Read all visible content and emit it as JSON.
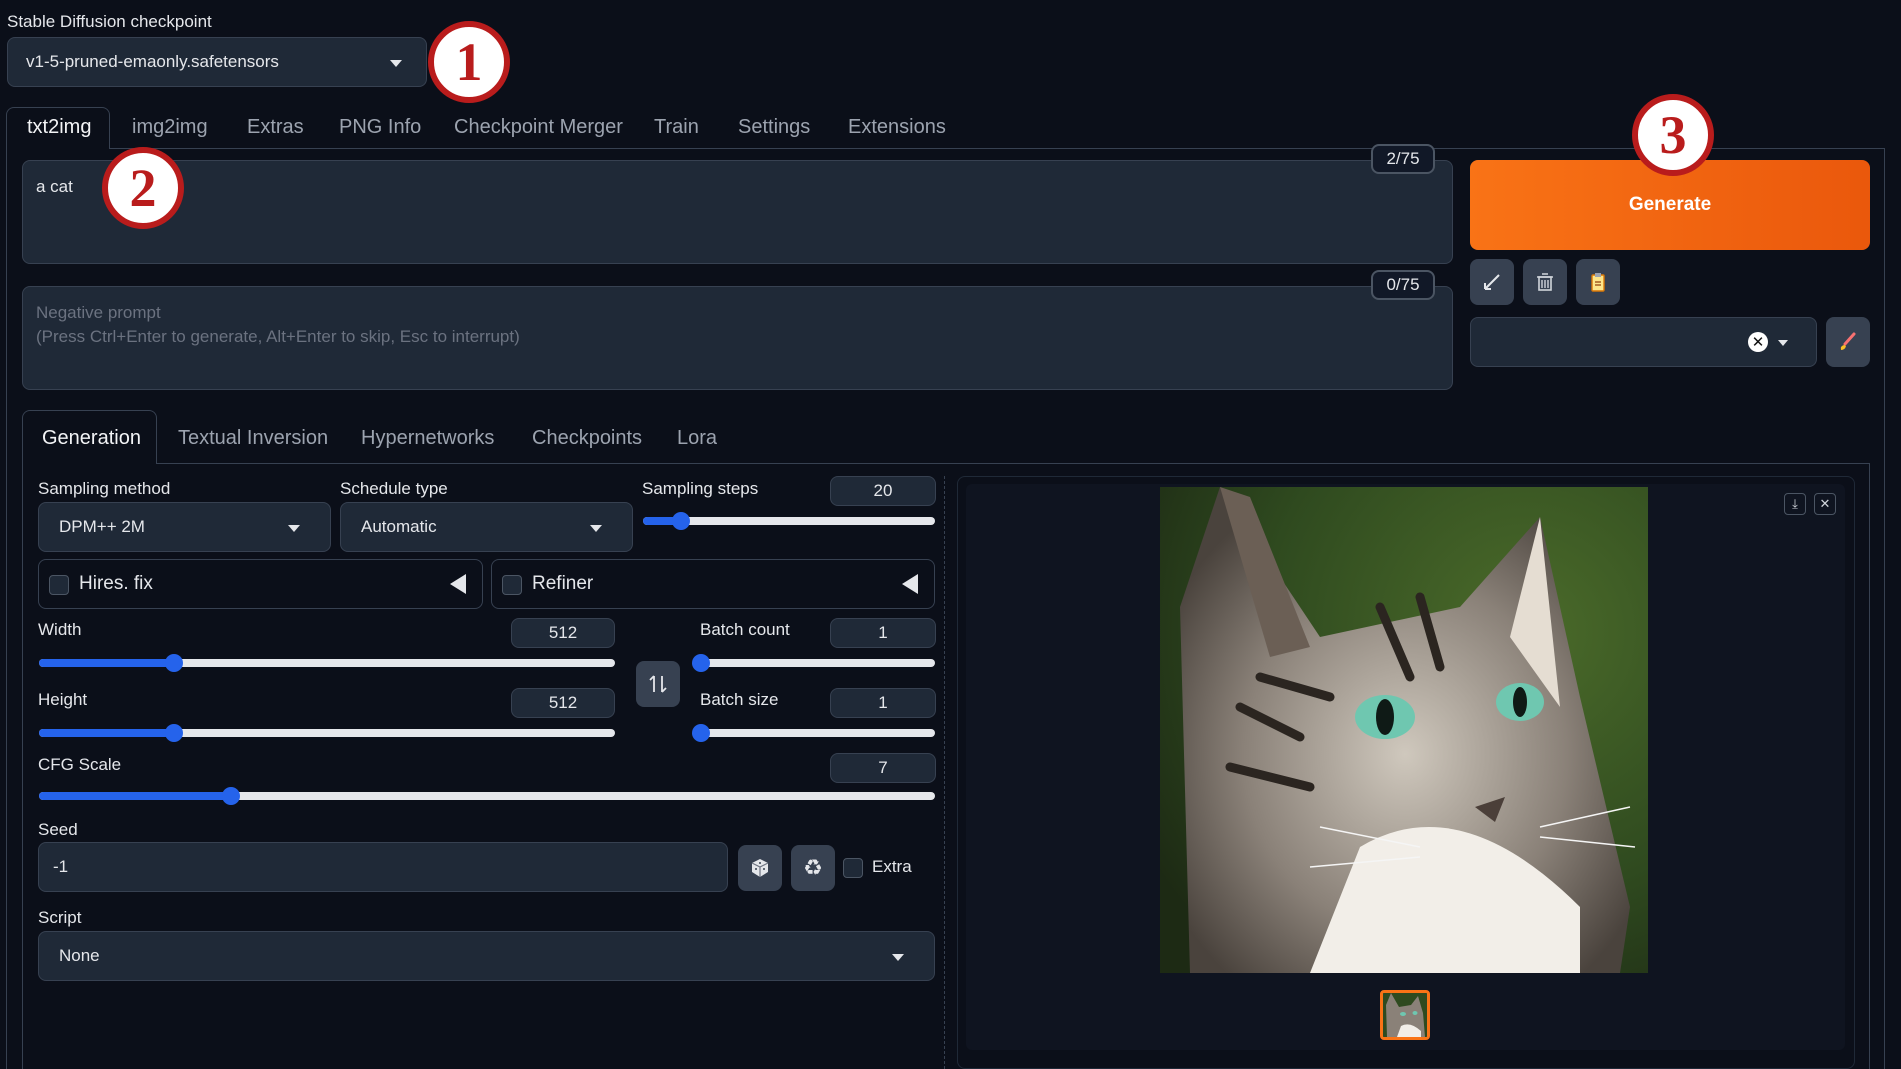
{
  "checkpoint": {
    "label": "Stable Diffusion checkpoint",
    "value": "v1-5-pruned-emaonly.safetensors"
  },
  "main_tabs": [
    "txt2img",
    "img2img",
    "Extras",
    "PNG Info",
    "Checkpoint Merger",
    "Train",
    "Settings",
    "Extensions"
  ],
  "prompt": {
    "value": "a cat",
    "counter": "2/75"
  },
  "negative_prompt": {
    "placeholder_line1": "Negative prompt",
    "placeholder_line2": "(Press Ctrl+Enter to generate, Alt+Enter to skip, Esc to interrupt)",
    "counter": "0/75"
  },
  "generate_label": "Generate",
  "sub_tabs": [
    "Generation",
    "Textual Inversion",
    "Hypernetworks",
    "Checkpoints",
    "Lora"
  ],
  "sampling_method": {
    "label": "Sampling method",
    "value": "DPM++ 2M"
  },
  "schedule_type": {
    "label": "Schedule type",
    "value": "Automatic"
  },
  "sampling_steps": {
    "label": "Sampling steps",
    "value": "20",
    "fraction": 0.13
  },
  "hires_fix": {
    "label": "Hires. fix"
  },
  "refiner": {
    "label": "Refiner"
  },
  "width": {
    "label": "Width",
    "value": "512",
    "fraction": 0.235
  },
  "height": {
    "label": "Height",
    "value": "512",
    "fraction": 0.235
  },
  "batch_count": {
    "label": "Batch count",
    "value": "1",
    "fraction": 0.0
  },
  "batch_size": {
    "label": "Batch size",
    "value": "1",
    "fraction": 0.0
  },
  "cfg_scale": {
    "label": "CFG Scale",
    "value": "7",
    "fraction": 0.214
  },
  "seed": {
    "label": "Seed",
    "value": "-1",
    "extra_label": "Extra"
  },
  "script": {
    "label": "Script",
    "value": "None"
  },
  "annotations": [
    "1",
    "2",
    "3"
  ],
  "colors": {
    "background": "#0b0f19",
    "accent": "#f97316",
    "slider": "#2563eb",
    "annotation": "#b91c1c"
  }
}
